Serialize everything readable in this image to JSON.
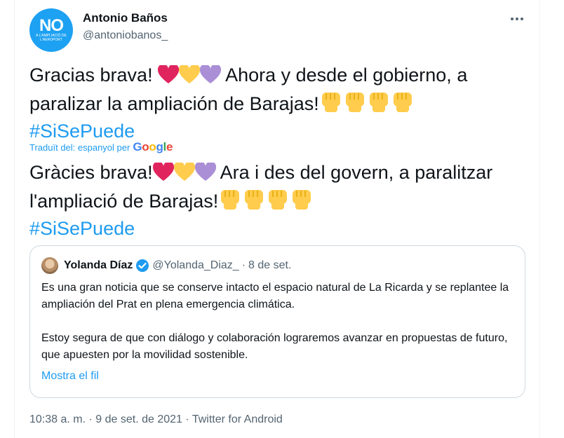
{
  "author": {
    "name": "Antonio Baños",
    "handle": "@antoniobanos_",
    "avatar_text_big": "NO",
    "avatar_text_small": "A L'AMPLIACIÓ DE L'AEROPORT"
  },
  "tweet": {
    "original_part1": "Gracias brava! ",
    "original_part2": " Ahora  y desde el gobierno, a paralizar la ampliación de Barajas!",
    "original_hashtag": "#SiSePuede",
    "translated_label": "Traduït del: espanyol per",
    "translation_provider": "Google",
    "translation_part1": "Gràcies brava!",
    "translation_part2": " Ara i des del govern, a paralitzar l'ampliació de Barajas!",
    "translation_hashtag": "#SiSePuede"
  },
  "quoted_tweet": {
    "name": "Yolanda Díaz",
    "handle": "@Yolanda_Diaz_",
    "separator": "·",
    "date": "8 de set.",
    "paragraph1": "Es una gran noticia que se conserve intacto el espacio natural de La Ricarda y se replantee la ampliación del Prat en plena emergencia climática.",
    "paragraph2": "Estoy segura de que con diálogo y colaboración lograremos avanzar en propuestas de futuro, que apuesten por la movilidad sostenible.",
    "show_thread": "Mostra el fil"
  },
  "footer": {
    "meta": "10:38 a. m. · 9 de set. de 2021 · Twitter for Android"
  },
  "colors": {
    "link": "#1d9bf0",
    "secondary_text": "#536471",
    "heart_red": "#e0245e",
    "heart_yellow": "#ffcc4d",
    "heart_purple": "#aa8ed6",
    "fist_yellow": "#ffcc4d"
  },
  "icons": {
    "more": "more-options-icon",
    "verified": "verified-badge-icon",
    "hearts": [
      "red-heart-icon",
      "yellow-heart-icon",
      "purple-heart-icon"
    ],
    "fist": "raised-fist-icon"
  }
}
